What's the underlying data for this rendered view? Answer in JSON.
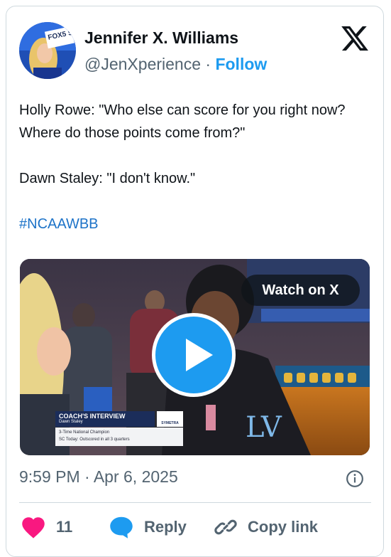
{
  "author": {
    "display_name": "Jennifer X. Williams",
    "handle": "@JenXperience",
    "separator": "·",
    "follow_label": "Follow",
    "avatar_badge": "FOX5 SPORTS"
  },
  "tweet": {
    "line1": "Holly Rowe: \"Who else can score for you right now?",
    "line2": "Where do those points come from?\"",
    "line3": "Dawn Staley: \"I don't know.\"",
    "hashtag": "#NCAAWBB"
  },
  "media": {
    "watch_label": "Watch on X",
    "lower_third": {
      "title": "COACH'S INTERVIEW",
      "name": "Dawn Staley",
      "sponsor": "SYMETRA",
      "line1": "3-Time National Champion",
      "line2": "SC Today: Outscored in all 3 quarters"
    }
  },
  "meta": {
    "timestamp": "9:59 PM · Apr 6, 2025"
  },
  "actions": {
    "like_count": "11",
    "reply_label": "Reply",
    "copy_link_label": "Copy link"
  },
  "colors": {
    "accent": "#1d9bf0",
    "heart": "#f91880",
    "muted": "#536471"
  }
}
